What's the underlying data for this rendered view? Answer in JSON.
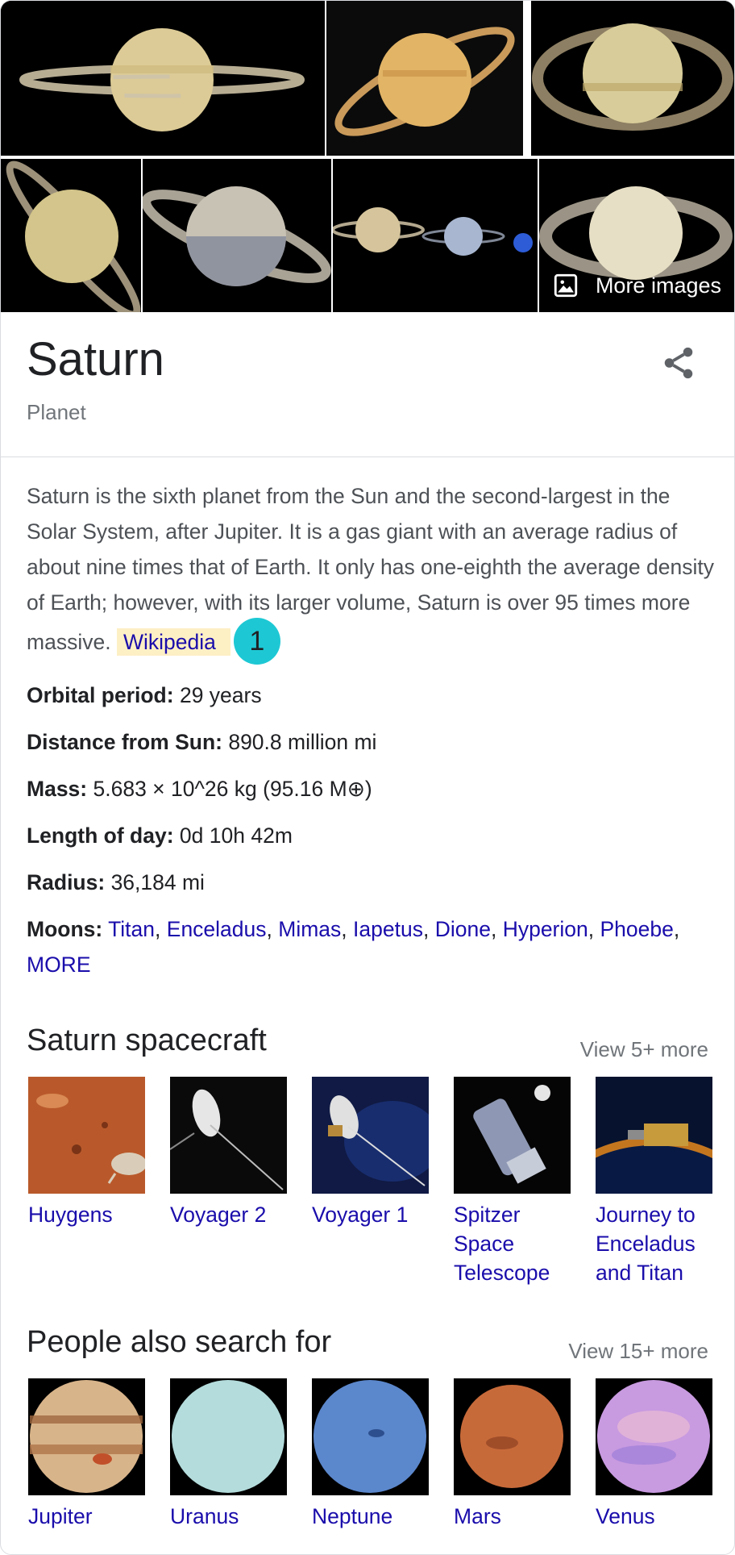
{
  "gallery": {
    "more_images_label": "More images"
  },
  "entity": {
    "title": "Saturn",
    "subtitle": "Planet"
  },
  "description": {
    "text": "Saturn is the sixth planet from the Sun and the second-largest in the Solar System, after Jupiter. It is a gas giant with an average radius of about nine times that of Earth. It only has one-eighth the average density of Earth; however, with its larger volume, Saturn is over 95 times more massive.",
    "source_link": "Wikipedia",
    "badge": "1"
  },
  "facts": [
    {
      "label": "Orbital period:",
      "value": "29 years"
    },
    {
      "label": "Distance from Sun:",
      "value": "890.8 million mi"
    },
    {
      "label": "Mass:",
      "value": "5.683 × 10^26 kg (95.16 M⊕)"
    },
    {
      "label": "Length of day:",
      "value": "0d 10h 42m"
    },
    {
      "label": "Radius:",
      "value": "36,184 mi"
    }
  ],
  "moons": {
    "label": "Moons:",
    "items": [
      "Titan",
      "Enceladus",
      "Mimas",
      "Iapetus",
      "Dione",
      "Hyperion",
      "Phoebe"
    ],
    "more": "MORE"
  },
  "spacecraft": {
    "title": "Saturn spacecraft",
    "view_more": "View 5+ more",
    "items": [
      {
        "label": "Huygens"
      },
      {
        "label": "Voyager 2"
      },
      {
        "label": "Voyager 1"
      },
      {
        "label": "Spitzer Space Telescope"
      },
      {
        "label": "Journey to Enceladus and Titan"
      }
    ]
  },
  "related": {
    "title": "People also search for",
    "view_more": "View 15+ more",
    "items": [
      {
        "label": "Jupiter"
      },
      {
        "label": "Uranus"
      },
      {
        "label": "Neptune"
      },
      {
        "label": "Mars"
      },
      {
        "label": "Venus"
      }
    ]
  }
}
